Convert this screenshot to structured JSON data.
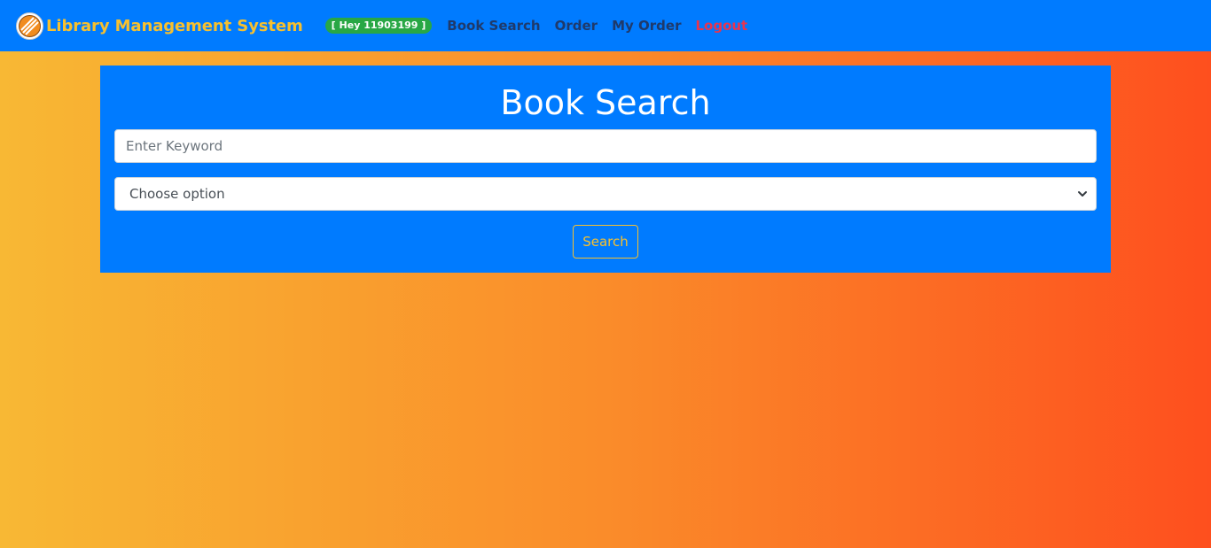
{
  "navbar": {
    "brand_title": "Library Management System",
    "user_badge": "[ Hey 11903199 ]",
    "links": [
      {
        "label": "Book Search"
      },
      {
        "label": "Order"
      },
      {
        "label": "My Order"
      },
      {
        "label": "Logout"
      }
    ],
    "logo_icon": "university-logo-icon"
  },
  "search": {
    "title": "Book Search",
    "keyword_placeholder": "Enter Keyword",
    "keyword_value": "",
    "select_value": "Choose option",
    "button_label": "Search"
  },
  "colors": {
    "navbar_bg": "#007bff",
    "brand": "#f7c02e",
    "badge": "#28a745",
    "nav_link": "#1f3a6b",
    "logout": "#e8344f",
    "gradient_start": "#f8b834",
    "gradient_end": "#fe4f1e"
  }
}
